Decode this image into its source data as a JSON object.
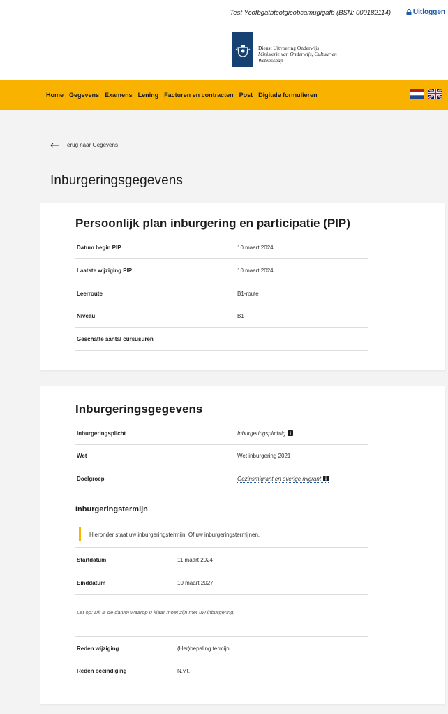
{
  "topbar": {
    "user_info": "Test Ycofbgatbtcotgicobcamugigafb (BSN: 000182114)",
    "logout_label": "Uitloggen"
  },
  "header": {
    "org_name": "Dienst Uitvoering Onderwijs",
    "ministry_line1": "Ministerie van Onderwijs, Cultuur en",
    "ministry_line2": "Wetenschap"
  },
  "nav": {
    "items": [
      {
        "label": "Home"
      },
      {
        "label": "Gegevens"
      },
      {
        "label": "Examens"
      },
      {
        "label": "Lening"
      },
      {
        "label": "Facturen en contracten"
      },
      {
        "label": "Post"
      },
      {
        "label": "Digitale formulieren"
      }
    ]
  },
  "back_link": "Terug naar Gegevens",
  "page_title": "Inburgeringsgegevens",
  "pip": {
    "title": "Persoonlijk plan inburgering en participatie (PIP)",
    "rows": [
      {
        "label": "Datum begin PIP",
        "value": "10 maart 2024"
      },
      {
        "label": "Laatste wijziging PIP",
        "value": "10 maart 2024"
      },
      {
        "label": "Leerroute",
        "value": "B1-route"
      },
      {
        "label": "Niveau",
        "value": "B1"
      },
      {
        "label": "Geschatte aantal cursusuren",
        "value": ""
      }
    ]
  },
  "inburgering": {
    "title": "Inburgeringsgegevens",
    "rows": [
      {
        "label": "Inburgeringsplicht",
        "value": "Inburgeringsplichtig"
      },
      {
        "label": "Wet",
        "value": "Wet inburgering 2021"
      },
      {
        "label": "Doelgroep",
        "value": "Gezinsmigrant en overige migrant"
      }
    ],
    "termijn_title": "Inburgeringstermijn",
    "notice": "Hieronder staat uw inburgeringstermijn. Of uw inburgeringstermijnen.",
    "termijn_rows": [
      {
        "label": "Startdatum",
        "value": "11 maart 2024"
      },
      {
        "label": "Einddatum",
        "value": "10 maart 2027"
      }
    ],
    "note": "Let op: Dit is de datum waarop u klaar moet zijn met uw inburgering.",
    "reden_rows": [
      {
        "label": "Reden wijziging",
        "value": "(Her)bepaling termijn"
      },
      {
        "label": "Reden beëindiging",
        "value": "N.v.t."
      }
    ]
  },
  "colors": {
    "nav_bg": "#f9b200",
    "logo_bg": "#154273",
    "link": "#1e5aa8"
  }
}
